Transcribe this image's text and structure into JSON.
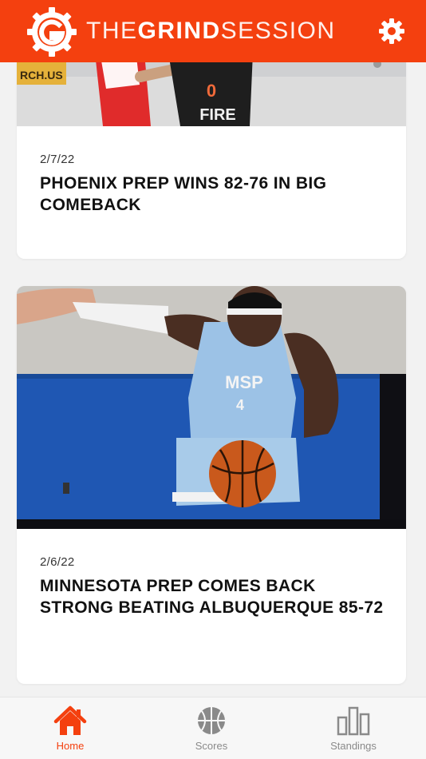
{
  "header": {
    "brand_thin_1": "THE",
    "brand_bold": "GRIND",
    "brand_thin_2": "SESSION",
    "accent_color": "#f4400f",
    "logo_icon": "grind-session-logo-icon",
    "settings_icon": "gear-icon"
  },
  "feed": {
    "items": [
      {
        "date": "2/7/22",
        "title": "PHOENIX PREP WINS 82-76 IN BIG COMEBACK",
        "photo_sign": "RCH.US",
        "jersey_number": "0",
        "jersey_text": "FIRE"
      },
      {
        "date": "2/6/22",
        "title": "MINNESOTA PREP COMES BACK STRONG BEATING ALBUQUERQUE 85-72",
        "jersey_text": "MSP",
        "jersey_number": "4"
      }
    ]
  },
  "tabbar": {
    "active_color": "#f4400f",
    "inactive_color": "#8a8a8a",
    "tabs": [
      {
        "label": "Home",
        "icon": "home-icon",
        "active": true
      },
      {
        "label": "Scores",
        "icon": "basketball-icon",
        "active": false
      },
      {
        "label": "Standings",
        "icon": "bar-chart-icon",
        "active": false
      }
    ]
  }
}
